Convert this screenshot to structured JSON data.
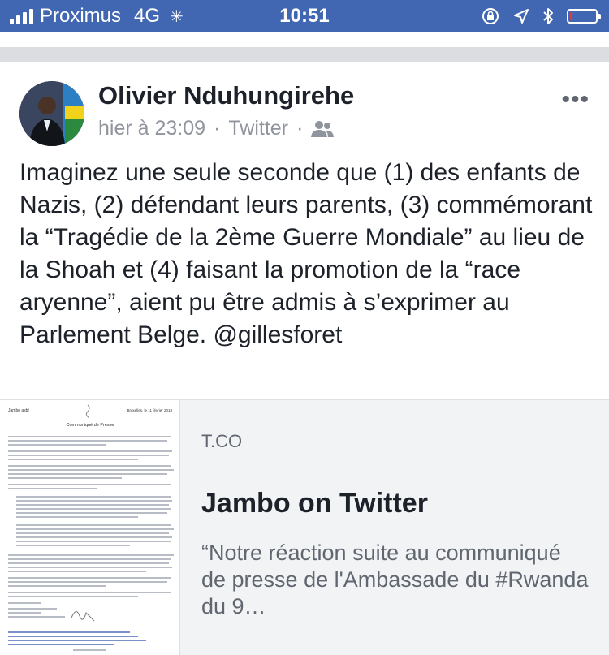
{
  "status_bar": {
    "carrier": "Proximus",
    "network": "4G",
    "time": "10:51"
  },
  "post": {
    "author": "Olivier Nduhungirehe",
    "timestamp": "hier à 23:09",
    "separator": "·",
    "source": "Twitter",
    "audience_icon": "friends-icon",
    "more_label": "•••",
    "text": "Imaginez une seule seconde que (1) des enfants de Nazis, (2) défendant leurs parents, (3) commémorant la “Tragédie de la 2ème Guerre Mondiale” au lieu de la Shoah et (4) faisant la promotion de la “race aryenne”, aient pu être admis à s’exprimer au Parlement Belge. @gillesforet"
  },
  "link_preview": {
    "domain": "T.CO",
    "title": "Jambo on Twitter",
    "description": "“Notre réaction suite au communiqué de presse de l'Ambassade du #Rwanda du 9…",
    "thumbnail": {
      "header_left": "Jambo asbl",
      "header_right": "Bruxelles, le 11 février 2018",
      "heading": "Communiqué de Presse"
    }
  }
}
